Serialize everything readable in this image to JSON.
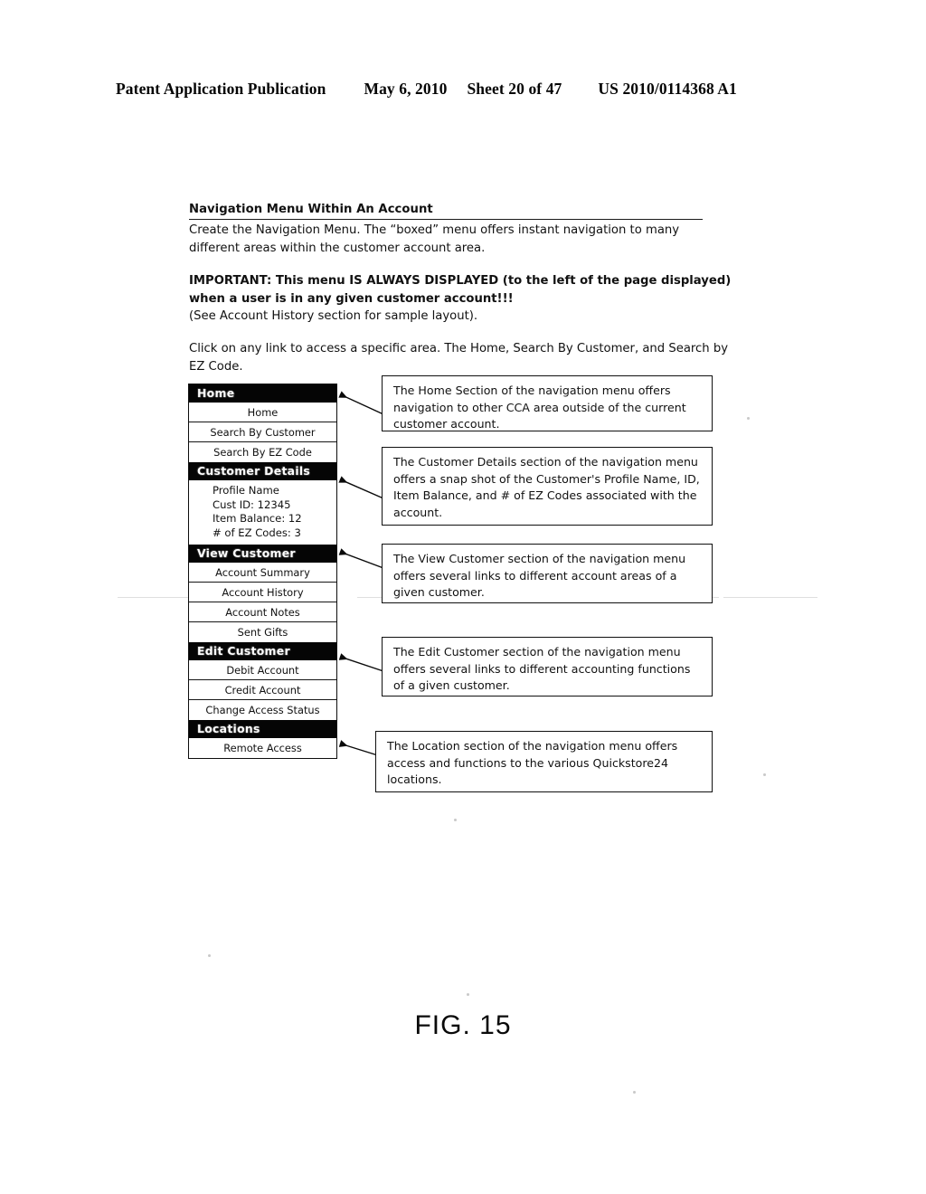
{
  "page_header": {
    "publication": "Patent Application Publication",
    "date": "May 6, 2010",
    "sheet": "Sheet 20 of 47",
    "patent_number": "US 2010/0114368 A1"
  },
  "document": {
    "title": "Navigation Menu Within An Account",
    "paragraph_1": "Create the Navigation Menu.  The “boxed” menu offers instant navigation to many different areas within the customer account area.",
    "paragraph_2_bold": "IMPORTANT: This menu IS ALWAYS DISPLAYED (to the left of the page displayed) when a user is in any given customer account!!!",
    "paragraph_2_normal": "(See Account History section for sample layout).",
    "paragraph_3": "Click on any link to access a specific area. The Home, Search By Customer, and Search by EZ Code."
  },
  "nav_menu": {
    "sections": [
      {
        "header": "Home",
        "items": [
          "Home",
          "Search By Customer",
          "Search By EZ Code"
        ]
      },
      {
        "header": "Customer Details",
        "details": [
          "Profile Name",
          "Cust ID: 12345",
          "Item Balance: 12",
          "# of EZ Codes: 3"
        ]
      },
      {
        "header": "View Customer",
        "items": [
          "Account Summary",
          "Account History",
          "Account Notes",
          "Sent Gifts"
        ]
      },
      {
        "header": "Edit Customer",
        "items": [
          "Debit Account",
          "Credit Account",
          "Change Access Status"
        ]
      },
      {
        "header": "Locations",
        "items": [
          "Remote Access"
        ]
      }
    ]
  },
  "callouts": [
    {
      "text": "The Home Section of the navigation menu offers navigation to other CCA area outside of the current customer account."
    },
    {
      "text": "The Customer Details section of the navigation menu offers a snap shot of the Customer's Profile Name, ID, Item Balance, and # of EZ Codes associated with the account."
    },
    {
      "text": "The View Customer section of the navigation menu offers several links to different account areas of a given customer."
    },
    {
      "text": "The Edit Customer section of the navigation menu offers several links to different accounting functions of a given customer."
    },
    {
      "text": "The Location section of the navigation menu offers access and functions to the various Quickstore24 locations."
    }
  ],
  "figure_caption": "FIG. 15",
  "colors": {
    "ink": "#111111",
    "header_bar": "#050505",
    "paper": "#ffffff"
  }
}
